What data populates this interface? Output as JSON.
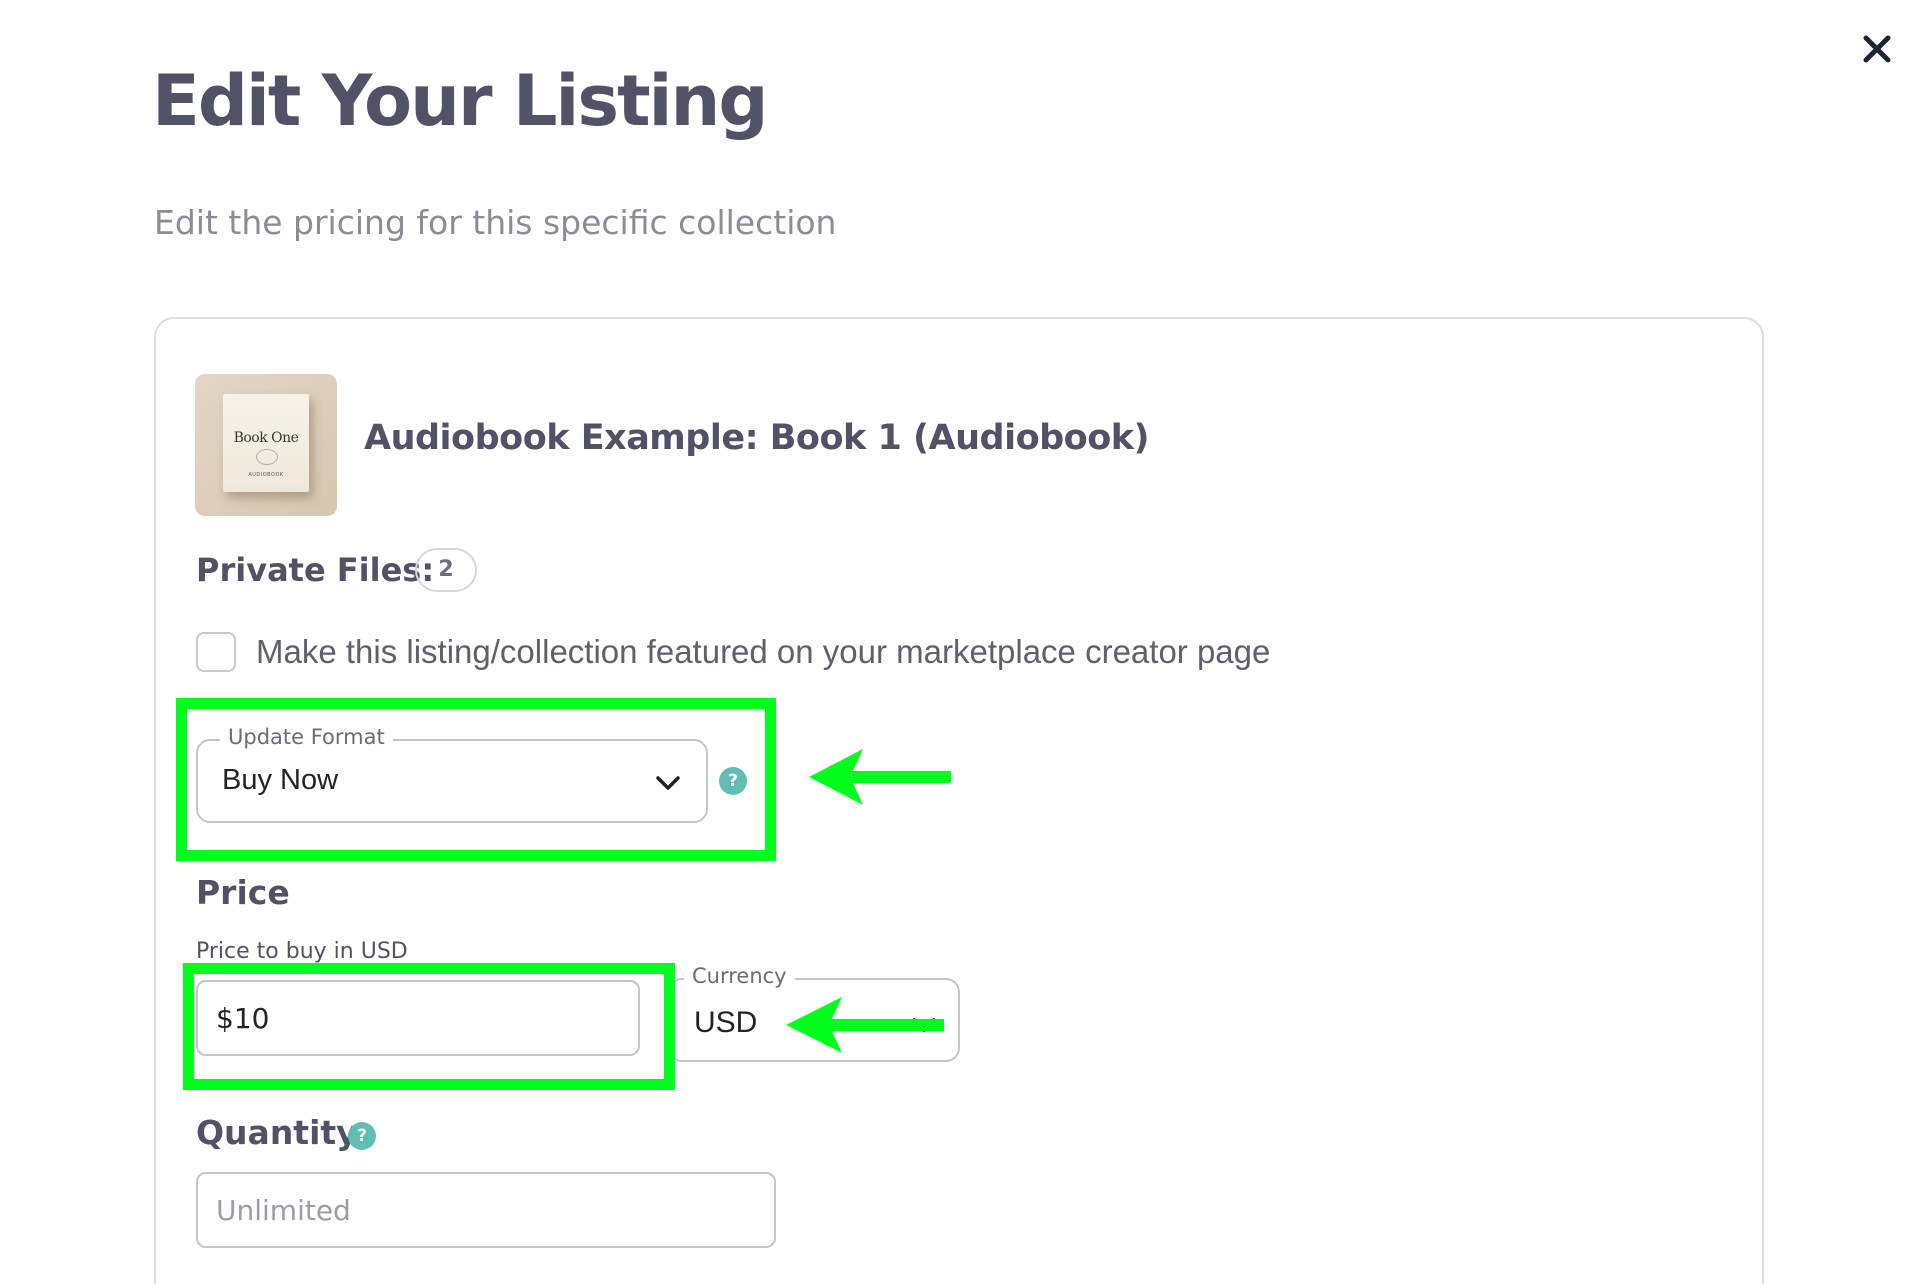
{
  "dialog": {
    "title": "Edit Your Listing",
    "subtitle": "Edit the pricing for this specific collection",
    "close_icon": "close-icon"
  },
  "listing": {
    "thumbnail": {
      "book_title": "Book One",
      "book_subtitle": "AUDIOBOOK"
    },
    "name": "Audiobook Example: Book 1 (Audiobook)",
    "private_files_label": "Private Files:",
    "private_files_count": "2",
    "featured_checked": false,
    "featured_label": "Make this listing/collection featured on your marketplace creator page"
  },
  "format": {
    "legend": "Update Format",
    "value": "Buy Now",
    "help_icon": "question-icon"
  },
  "price": {
    "heading": "Price",
    "sublabel": "Price to buy in USD",
    "value": "$10",
    "currency_legend": "Currency",
    "currency_value": "USD"
  },
  "quantity": {
    "heading": "Quantity",
    "placeholder": "Unlimited",
    "help_icon": "question-icon"
  },
  "annotations": {
    "highlight_color": "#00ff1f",
    "text_color": "#525266",
    "help_color": "#5fbfb3"
  }
}
